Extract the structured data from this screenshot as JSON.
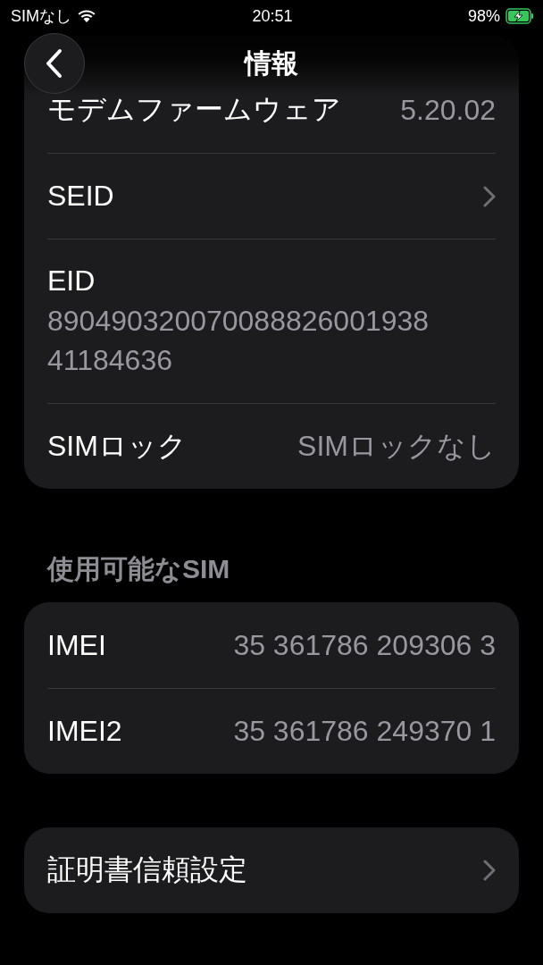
{
  "status_bar": {
    "carrier": "SIMなし",
    "time": "20:51",
    "battery": "98%",
    "charging": true
  },
  "nav": {
    "title": "情報"
  },
  "groups": [
    {
      "rows": [
        {
          "kind": "value",
          "label": "モデムファームウェア",
          "value": "5.20.02"
        },
        {
          "kind": "link",
          "label": "SEID"
        },
        {
          "kind": "stacked",
          "label": "EID",
          "value": "89049032007008882600193841184636"
        },
        {
          "kind": "value",
          "label": "SIMロック",
          "value": "SIMロックなし"
        }
      ]
    },
    {
      "header": "使用可能なSIM",
      "rows": [
        {
          "kind": "value",
          "label": "IMEI",
          "value": "35 361786 209306 3"
        },
        {
          "kind": "value",
          "label": "IMEI2",
          "value": "35 361786 249370 1"
        }
      ]
    },
    {
      "rows": [
        {
          "kind": "link",
          "label": "証明書信頼設定"
        }
      ]
    }
  ]
}
